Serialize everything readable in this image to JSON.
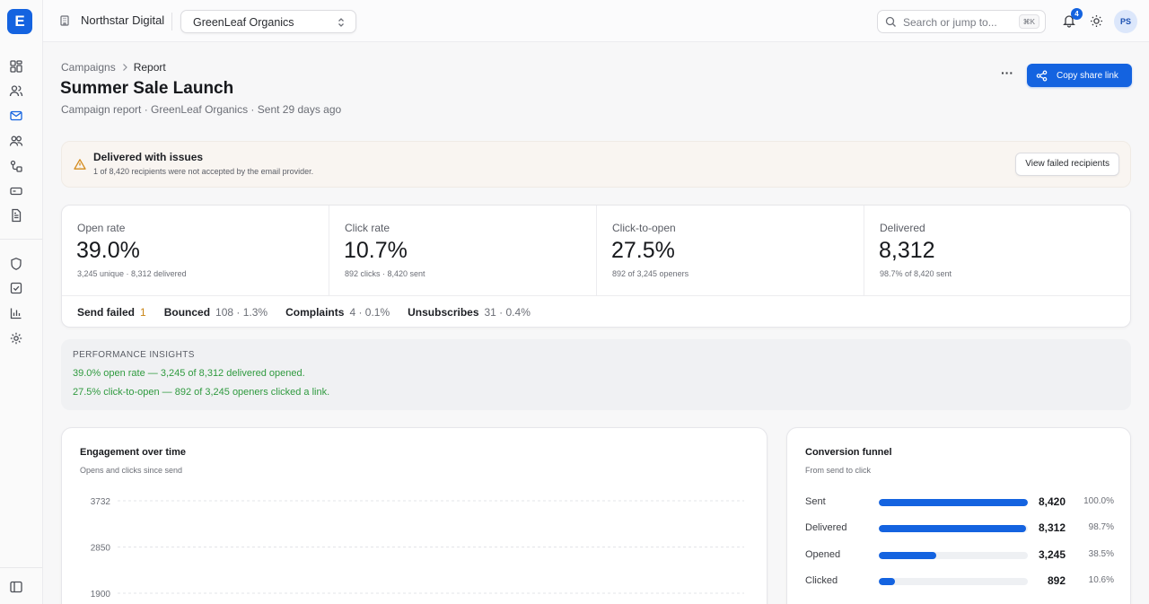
{
  "app": {
    "logo_letter": "E",
    "org_name": "Northstar Digital",
    "client": "GreenLeaf Organics"
  },
  "topbar": {
    "search_placeholder": "Search or jump to...",
    "search_shortcut": "⌘K",
    "notifications": "4",
    "user_initials": "PS"
  },
  "sidebar": {
    "items": [
      "dashboard-icon",
      "contacts-icon",
      "mail-icon",
      "audience-icon",
      "automation-icon",
      "forms-icon",
      "templates-icon",
      "shield-icon",
      "tasks-icon",
      "reports-icon",
      "settings-icon"
    ],
    "active": "mail-icon"
  },
  "header": {
    "breadcrumb": [
      "Campaigns",
      "Report"
    ],
    "title": "Summer Sale Launch",
    "subtitle": "Campaign report · GreenLeaf Organics · Sent 29 days ago",
    "more_label": "···",
    "share_label": "Copy share link"
  },
  "alert": {
    "title": "Delivered with issues",
    "message": "1 of 8,420 recipients were not accepted by the email provider.",
    "action": "View failed recipients"
  },
  "metrics": [
    {
      "label": "Open rate",
      "value": "39.0%",
      "sub": "3,245 unique · 8,312 delivered"
    },
    {
      "label": "Click rate",
      "value": "10.7%",
      "sub": "892 clicks · 8,420 sent"
    },
    {
      "label": "Click-to-open",
      "value": "27.5%",
      "sub": "892 of 3,245 openers"
    },
    {
      "label": "Delivered",
      "value": "8,312",
      "sub": "98.7% of 8,420 sent"
    }
  ],
  "footer_stats": [
    {
      "label": "Send failed",
      "value": "1"
    },
    {
      "label": "Bounced",
      "value": "108 · 1.3%"
    },
    {
      "label": "Complaints",
      "value": "4 · 0.1%"
    },
    {
      "label": "Unsubscribes",
      "value": "31 · 0.4%"
    }
  ],
  "insights": {
    "heading": "PERFORMANCE INSIGHTS",
    "lines": [
      "39.0% open rate — 3,245 of 8,312 delivered opened.",
      "27.5% click-to-open — 892 of 3,245 openers clicked a link."
    ]
  },
  "engagement": {
    "title": "Engagement over time",
    "subtitle": "Opens and clicks since send"
  },
  "chart_data": {
    "type": "line",
    "title": "Engagement over time",
    "subtitle": "Opens and clicks since send",
    "y_ticks": [
      3732,
      2850,
      1900
    ],
    "grid": true
  },
  "funnel": {
    "title": "Conversion funnel",
    "subtitle": "From send to click",
    "rows": [
      {
        "label": "Sent",
        "value": "8,420",
        "pct": "100.0%",
        "fraction": 1.0
      },
      {
        "label": "Delivered",
        "value": "8,312",
        "pct": "98.7%",
        "fraction": 0.987
      },
      {
        "label": "Opened",
        "value": "3,245",
        "pct": "38.5%",
        "fraction": 0.385
      },
      {
        "label": "Clicked",
        "value": "892",
        "pct": "10.6%",
        "fraction": 0.106
      }
    ]
  },
  "colors": {
    "accent": "#1463e0",
    "success": "#2f9a3f",
    "warning": "#d48a1c"
  }
}
